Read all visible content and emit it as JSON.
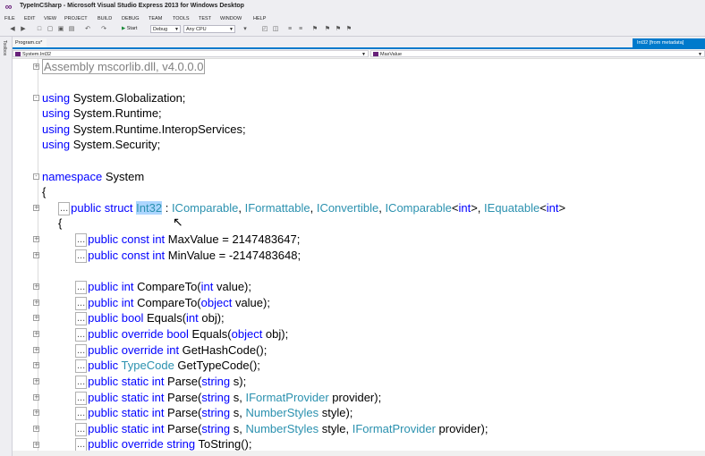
{
  "window": {
    "title": "TypeInCSharp - Microsoft Visual Studio Express 2013 for Windows Desktop",
    "logo": "vs-logo-icon"
  },
  "menu": [
    "FILE",
    "EDIT",
    "VIEW",
    "PROJECT",
    "BUILD",
    "DEBUG",
    "TEAM",
    "TOOLS",
    "TEST",
    "WINDOW",
    "HELP"
  ],
  "toolbar": {
    "start_label": "Start",
    "config": "Debug",
    "platform": "Any CPU"
  },
  "left_strip": {
    "label": "Toolbox"
  },
  "tabs": {
    "program": "Program.cs*",
    "metadata": "Int32 [from metadata]"
  },
  "navbar": {
    "type_combo": "System.Int32",
    "member_combo": "MaxValue"
  },
  "code": {
    "assembly": "Assembly mscorlib.dll, v4.0.0.0",
    "u1_kw": "using",
    "u1_ns": " System.Globalization;",
    "u2_kw": "using",
    "u2_ns": " System.Runtime;",
    "u3_kw": "using",
    "u3_ns": " System.Runtime.InteropServices;",
    "u4_kw": "using",
    "u4_ns": " System.Security;",
    "ns_kw": "namespace",
    "ns_name": " System",
    "brace_open": "{",
    "struct": {
      "dots": "...",
      "mods": "public struct",
      "sp": " ",
      "name": "Int32",
      "colon": " : ",
      "i1": "IComparable",
      "c1": ", ",
      "i2": "IFormattable",
      "c2": ", ",
      "i3": "IConvertible",
      "c3": ", ",
      "i4": "IComparable",
      "g1a": "<",
      "g1t": "int",
      "g1b": ">",
      "c4": ", ",
      "i5": "IEquatable",
      "g2a": "<",
      "g2t": "int",
      "g2b": ">"
    },
    "inner_brace": "{",
    "m": {
      "m1a": "public const int",
      "m1b": " MaxValue = 2147483647;",
      "m2a": "public const int",
      "m2b": " MinValue = -2147483648;",
      "m3a": "public int",
      "m3b": " CompareTo(",
      "m3c": "int",
      "m3d": " value);",
      "m4a": "public int",
      "m4b": " CompareTo(",
      "m4c": "object",
      "m4d": " value);",
      "m5a": "public bool",
      "m5b": " Equals(",
      "m5c": "int",
      "m5d": " obj);",
      "m6a": "public override bool",
      "m6b": " Equals(",
      "m6c": "object",
      "m6d": " obj);",
      "m7a": "public override int",
      "m7b": " GetHashCode();",
      "m8a": "public",
      "m8sp": " ",
      "m8t": "TypeCode",
      "m8b": " GetTypeCode();",
      "m9a": "public static int",
      "m9b": " Parse(",
      "m9c": "string",
      "m9d": " s);",
      "m10a": "public static int",
      "m10b": " Parse(",
      "m10c": "string",
      "m10d": " s, ",
      "m10t": "IFormatProvider",
      "m10e": " provider);",
      "m11a": "public static int",
      "m11b": " Parse(",
      "m11c": "string",
      "m11d": " s, ",
      "m11t": "NumberStyles",
      "m11e": " style);",
      "m12a": "public static int",
      "m12b": " Parse(",
      "m12c": "string",
      "m12d": " s, ",
      "m12t": "NumberStyles",
      "m12e": " style, ",
      "m12t2": "IFormatProvider",
      "m12f": " provider);",
      "m13a": "public override string",
      "m13b": " ToString();"
    }
  },
  "colors": {
    "keyword": "#0000ff",
    "type": "#2b91af",
    "accent": "#007acc",
    "selection": "#add6ff"
  }
}
